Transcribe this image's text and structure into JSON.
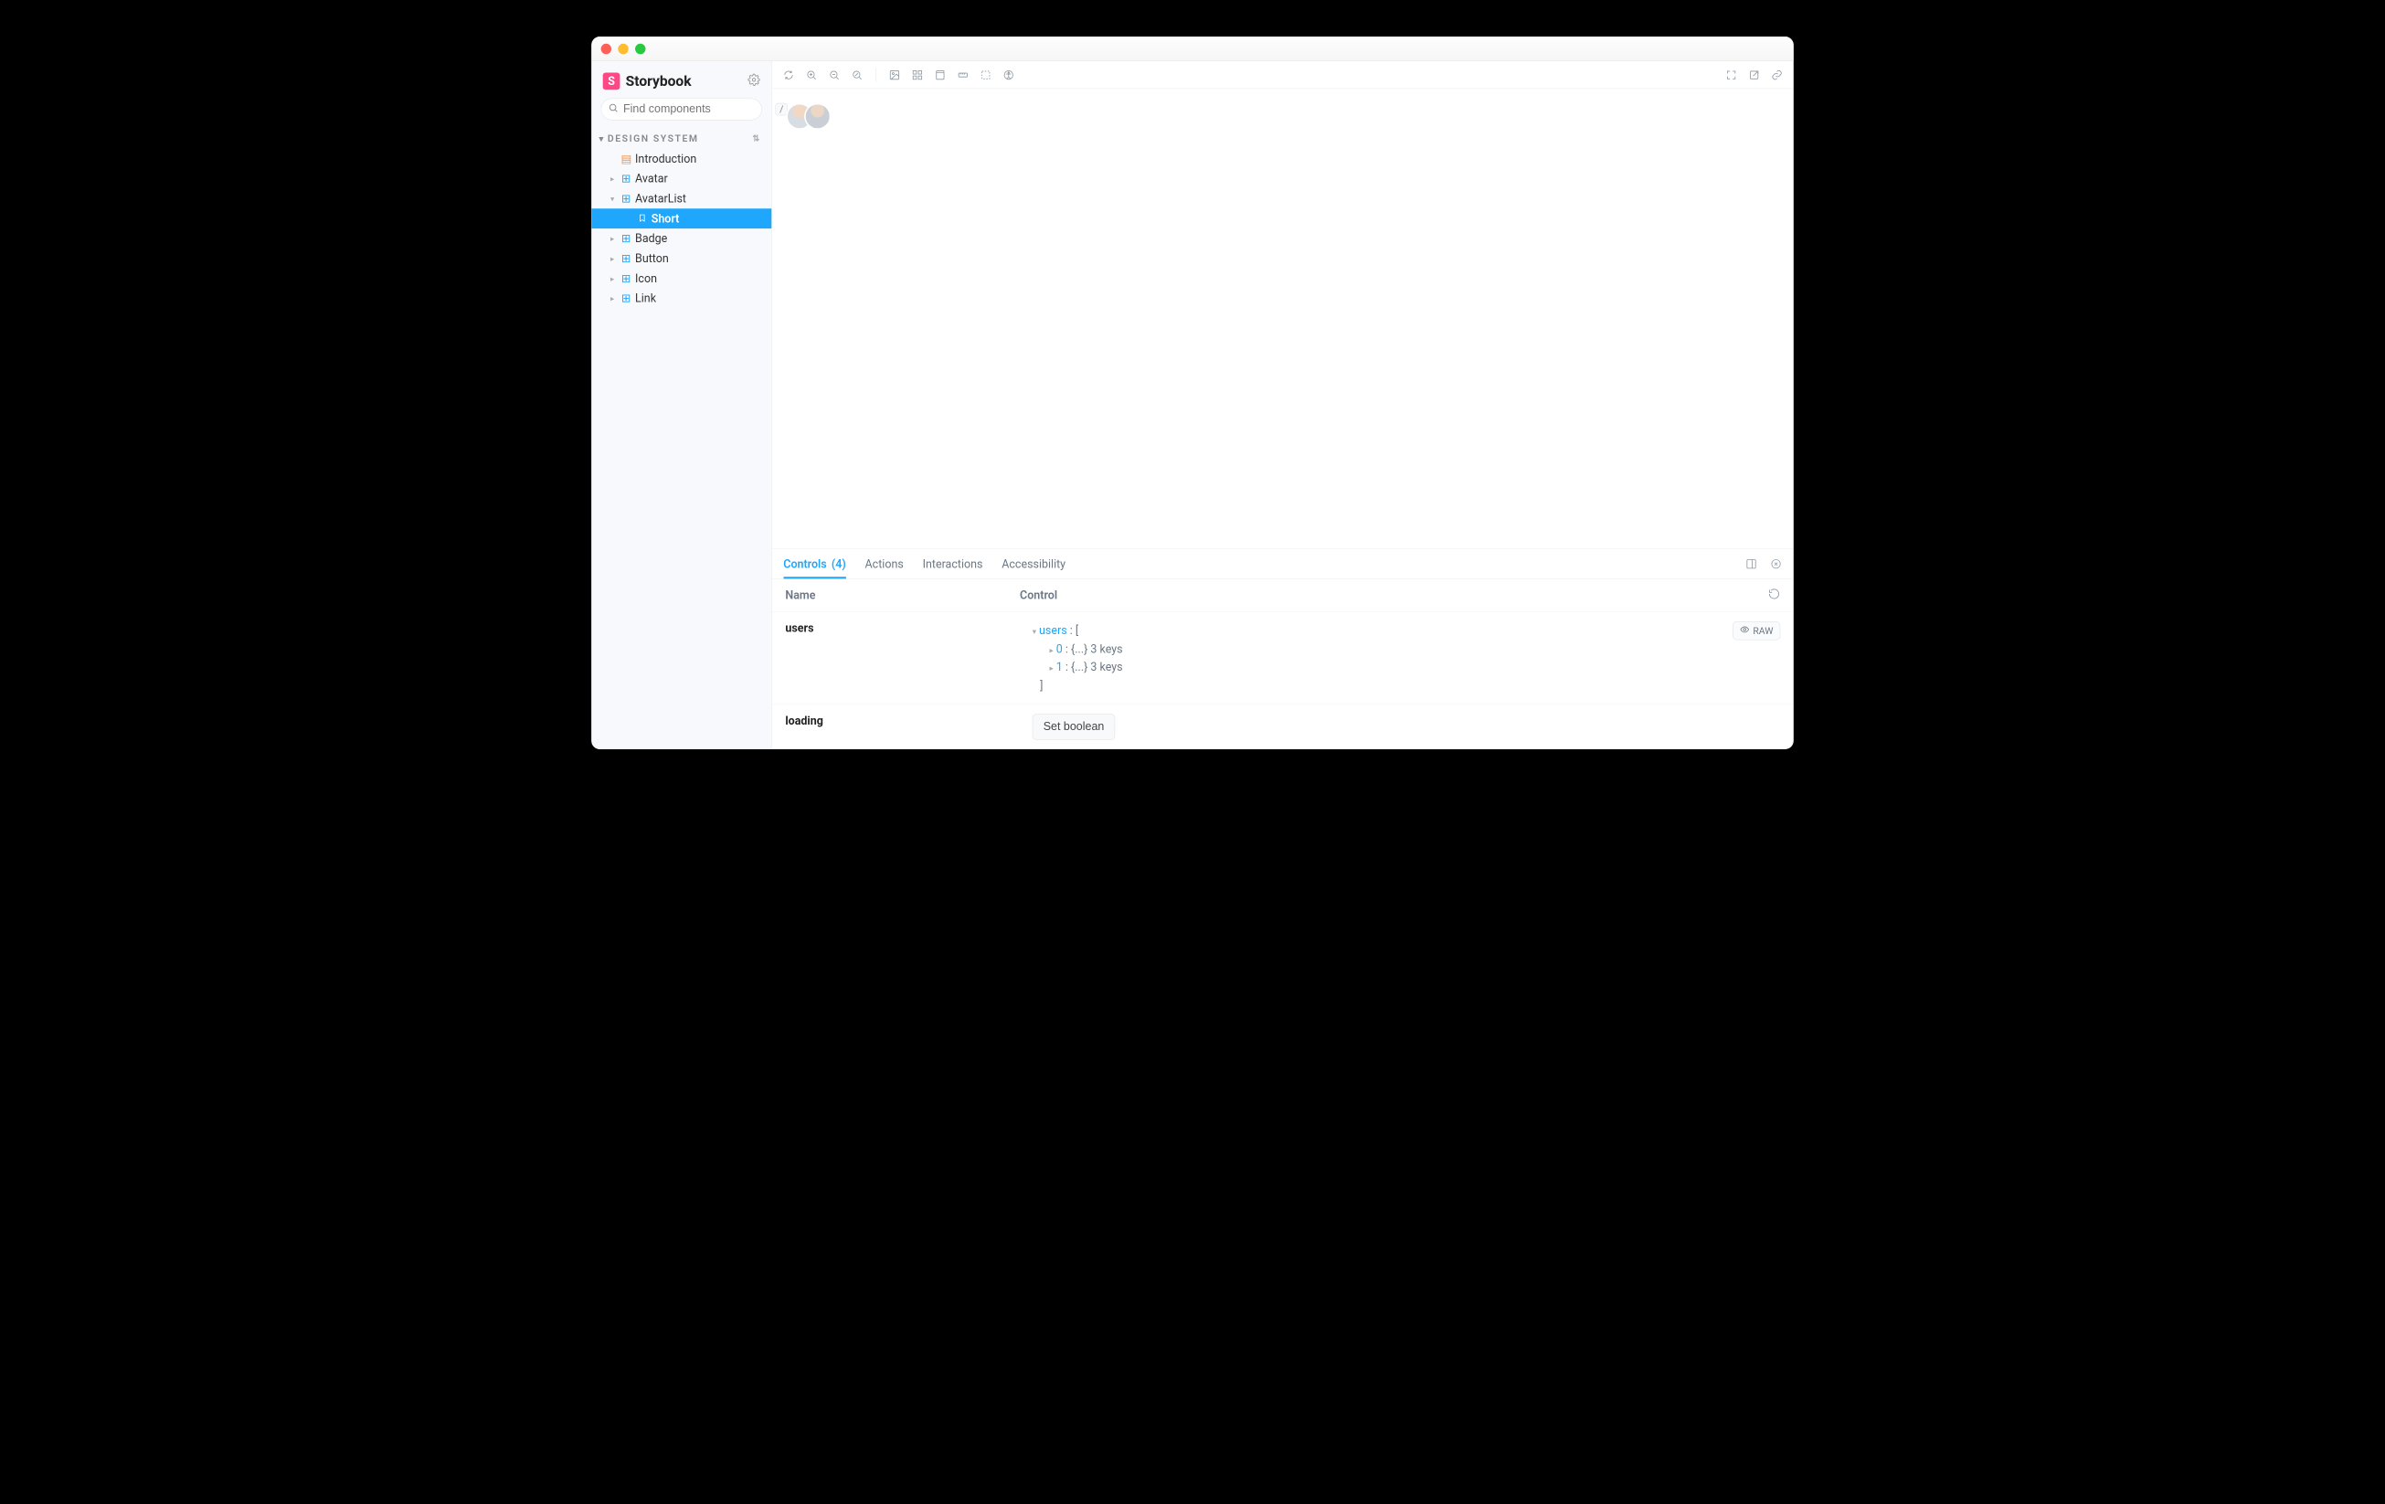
{
  "window": {
    "traffic_lights": [
      "close",
      "minimize",
      "zoom"
    ]
  },
  "brand": {
    "name": "Storybook",
    "logo_letter": "S"
  },
  "search": {
    "placeholder": "Find components",
    "shortcut": "/"
  },
  "sidebar": {
    "section_label": "DESIGN SYSTEM",
    "items": [
      {
        "label": "Introduction",
        "type": "doc"
      },
      {
        "label": "Avatar",
        "type": "component",
        "expanded": false
      },
      {
        "label": "AvatarList",
        "type": "component",
        "expanded": true,
        "stories": [
          {
            "label": "Short",
            "active": true
          }
        ]
      },
      {
        "label": "Badge",
        "type": "component",
        "expanded": false
      },
      {
        "label": "Button",
        "type": "component",
        "expanded": false
      },
      {
        "label": "Icon",
        "type": "component",
        "expanded": false
      },
      {
        "label": "Link",
        "type": "component",
        "expanded": false
      }
    ]
  },
  "canvas": {
    "avatar_count": 2
  },
  "addons": {
    "tabs": [
      {
        "label": "Controls",
        "count": 4,
        "active": true
      },
      {
        "label": "Actions"
      },
      {
        "label": "Interactions"
      },
      {
        "label": "Accessibility"
      }
    ],
    "header": {
      "name_col": "Name",
      "control_col": "Control"
    },
    "controls": [
      {
        "name": "users",
        "raw_label": "RAW",
        "tree": {
          "root_key": "users",
          "open_bracket": "[",
          "close_bracket": "]",
          "items": [
            {
              "index": "0",
              "summary": "{...} 3 keys"
            },
            {
              "index": "1",
              "summary": "{...} 3 keys"
            }
          ]
        }
      },
      {
        "name": "loading",
        "button_label": "Set boolean"
      }
    ]
  }
}
